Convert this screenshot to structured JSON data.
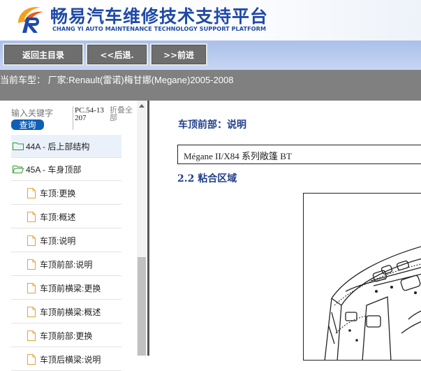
{
  "header": {
    "title": "畅易汽车维修技术支持平台",
    "subtitle": "CHANG YI AUTO MAINTENANCE TECHNOLOGY SUPPORT PLATFORM",
    "brand_color": "#1f4aa6"
  },
  "toolbar": {
    "home_label": "返回主目录",
    "back_label": "<<后退.",
    "forward_label": ">>前进"
  },
  "vehicle": {
    "text": "当前车型：  厂家:Renault(雷诺)梅甘娜(Megane)2005-2008"
  },
  "left_panel": {
    "search_placeholder": "输入关键字",
    "search_button": "查询",
    "pc_code": "PC.54-13207",
    "collapse_all": "折叠全部",
    "tree": [
      {
        "label": "44A - 后上部结构",
        "icon": "folder-icon"
      },
      {
        "label": "45A - 车身顶部",
        "icon": "folder-icon"
      },
      {
        "label": "车顶:更换",
        "icon": "document-icon"
      },
      {
        "label": "车顶:概述",
        "icon": "document-icon"
      },
      {
        "label": "车顶:说明",
        "icon": "document-icon"
      },
      {
        "label": "车顶前部:说明",
        "icon": "document-icon"
      },
      {
        "label": "车顶前横梁:更换",
        "icon": "document-icon"
      },
      {
        "label": "车顶前横梁:概述",
        "icon": "document-icon"
      },
      {
        "label": "车顶前部:更换",
        "icon": "document-icon"
      },
      {
        "label": "车顶后横梁:说明",
        "icon": "document-icon"
      }
    ]
  },
  "content": {
    "title": "车顶前部：说明",
    "model": "Mégane II/X84 系列敞篷 BT",
    "subsection": "2.2 粘合区域"
  }
}
